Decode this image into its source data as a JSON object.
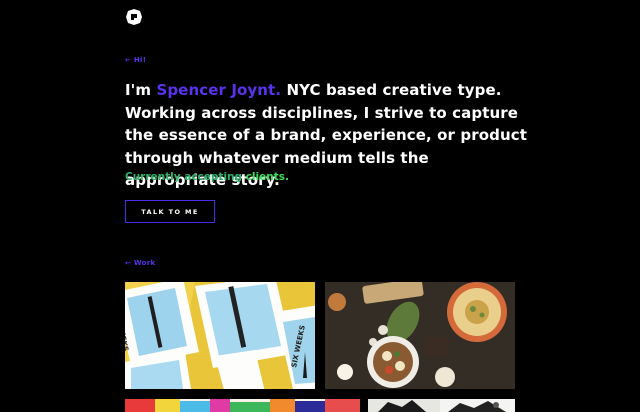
{
  "header": {
    "logo_icon": "brand-logo-icon"
  },
  "hi_link": {
    "label": "← Hi!"
  },
  "intro": {
    "prefix": "I'm ",
    "name": "Spencer Joynt.",
    "rest": " NYC based creative type. Working across disciplines, I strive to capture the essence of a brand, experience, or product through whatever medium tells the appropriate story."
  },
  "availability": {
    "prefix": "Currently accepting ",
    "highlight": "clients."
  },
  "cta": {
    "label": "TALK TO ME"
  },
  "work_link": {
    "label": "← Work"
  },
  "work": {
    "tiles": [
      {
        "caption": "SIX WEEKS"
      },
      {
        "caption": ""
      }
    ]
  },
  "colors": {
    "accent": "#5a32f0",
    "accepting": "#2fb36b",
    "clients": "#3ddc5c",
    "background": "#000000"
  }
}
